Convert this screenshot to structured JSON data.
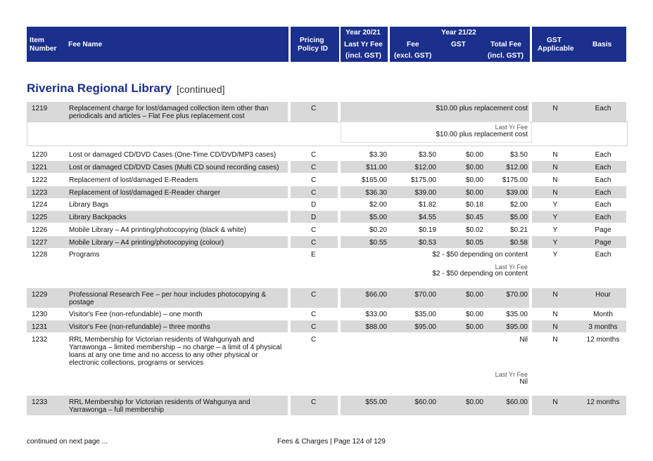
{
  "header": {
    "item_number": [
      "Item",
      "Number"
    ],
    "fee_name": "Fee Name",
    "pricing_policy": [
      "Pricing",
      "Policy ID"
    ],
    "year_prev": "Year 20/21",
    "year_curr": "Year 21/22",
    "last_yr_fee": [
      "Last Yr Fee",
      "(incl. GST)"
    ],
    "fee": [
      "Fee",
      "(excl. GST)"
    ],
    "gst": "GST",
    "total_fee": [
      "Total Fee",
      "(incl. GST)"
    ],
    "gst_applicable": [
      "GST",
      "Applicable"
    ],
    "basis": "Basis"
  },
  "section": {
    "title": "Riverina Regional Library",
    "continued": "[continued]"
  },
  "rows": [
    {
      "num": "1219",
      "name": "Replacement charge for lost/damaged collection item other than periodicals and articles – Flat Fee plus replacement cost",
      "policy": "C",
      "wide": "$10.00 plus replacement cost",
      "gst_app": "N",
      "basis": "Each",
      "last_label": "Last Yr Fee",
      "last_value": "$10.00 plus replacement cost"
    },
    {
      "num": "1220",
      "name": "Lost or damaged CD/DVD Cases (One-Time CD/DVD/MP3 cases)",
      "policy": "C",
      "last": "$3.30",
      "fee": "$3.50",
      "gst": "$0.00",
      "total": "$3.50",
      "gst_app": "N",
      "basis": "Each"
    },
    {
      "num": "1221",
      "name": "Lost or damaged CD/DVD Cases (Multi CD sound recording cases)",
      "policy": "C",
      "last": "$11.00",
      "fee": "$12.00",
      "gst": "$0.00",
      "total": "$12.00",
      "gst_app": "N",
      "basis": "Each"
    },
    {
      "num": "1222",
      "name": "Replacement of lost/damaged E-Readers",
      "policy": "C",
      "last": "$165.00",
      "fee": "$175.00",
      "gst": "$0.00",
      "total": "$175.00",
      "gst_app": "N",
      "basis": "Each"
    },
    {
      "num": "1223",
      "name": "Replacement of lost/damaged E-Reader charger",
      "policy": "C",
      "last": "$36.30",
      "fee": "$39.00",
      "gst": "$0.00",
      "total": "$39.00",
      "gst_app": "N",
      "basis": "Each"
    },
    {
      "num": "1224",
      "name": "Library Bags",
      "policy": "D",
      "last": "$2.00",
      "fee": "$1.82",
      "gst": "$0.18",
      "total": "$2.00",
      "gst_app": "Y",
      "basis": "Each"
    },
    {
      "num": "1225",
      "name": "Library Backpacks",
      "policy": "D",
      "last": "$5.00",
      "fee": "$4.55",
      "gst": "$0.45",
      "total": "$5.00",
      "gst_app": "Y",
      "basis": "Each"
    },
    {
      "num": "1226",
      "name": "Mobile Library – A4 printing/photocopying (black & white)",
      "policy": "C",
      "last": "$0.20",
      "fee": "$0.19",
      "gst": "$0.02",
      "total": "$0.21",
      "gst_app": "Y",
      "basis": "Page"
    },
    {
      "num": "1227",
      "name": "Mobile Library – A4 printing/photocopying (colour)",
      "policy": "C",
      "last": "$0.55",
      "fee": "$0.53",
      "gst": "$0.05",
      "total": "$0.58",
      "gst_app": "Y",
      "basis": "Page"
    },
    {
      "num": "1228",
      "name": "Programs",
      "policy": "E",
      "wide": "$2 - $50 depending on content",
      "gst_app": "Y",
      "basis": "Each",
      "last_label": "Last Yr Fee",
      "last_value": "$2 - $50 depending on content"
    },
    {
      "num": "1229",
      "name": "Professional Research Fee – per hour includes photocopying & postage",
      "policy": "C",
      "last": "$66.00",
      "fee": "$70.00",
      "gst": "$0.00",
      "total": "$70.00",
      "gst_app": "N",
      "basis": "Hour"
    },
    {
      "num": "1230",
      "name": "Visitor's Fee (non-refundable) – one month",
      "policy": "C",
      "last": "$33.00",
      "fee": "$35.00",
      "gst": "$0.00",
      "total": "$35.00",
      "gst_app": "N",
      "basis": "Month"
    },
    {
      "num": "1231",
      "name": "Visitor's Fee (non-refundable) – three months",
      "policy": "C",
      "last": "$88.00",
      "fee": "$95.00",
      "gst": "$0.00",
      "total": "$95.00",
      "gst_app": "N",
      "basis": "3 months"
    },
    {
      "num": "1232",
      "name": "RRL Membership for Victorian residents of Wahgunyah and Yarrawonga – limited membership – no charge – a limit of 4 physical loans at any one time and no access to any other physical or electronic collections, programs or services",
      "policy": "C",
      "wide": "Nil",
      "gst_app": "N",
      "basis": "12 months",
      "last_label": "Last Yr Fee",
      "last_value": "Nil"
    },
    {
      "num": "1233",
      "name": "RRL Membership for Victorian residents of Wahgunya and Yarrawonga – full membership",
      "policy": "C",
      "last": "$55.00",
      "fee": "$60.00",
      "gst": "$0.00",
      "total": "$60.00",
      "gst_app": "N",
      "basis": "12 months"
    }
  ],
  "footer": {
    "continued": "continued on next page ...",
    "page": "Fees & Charges | Page 124 of 129"
  }
}
